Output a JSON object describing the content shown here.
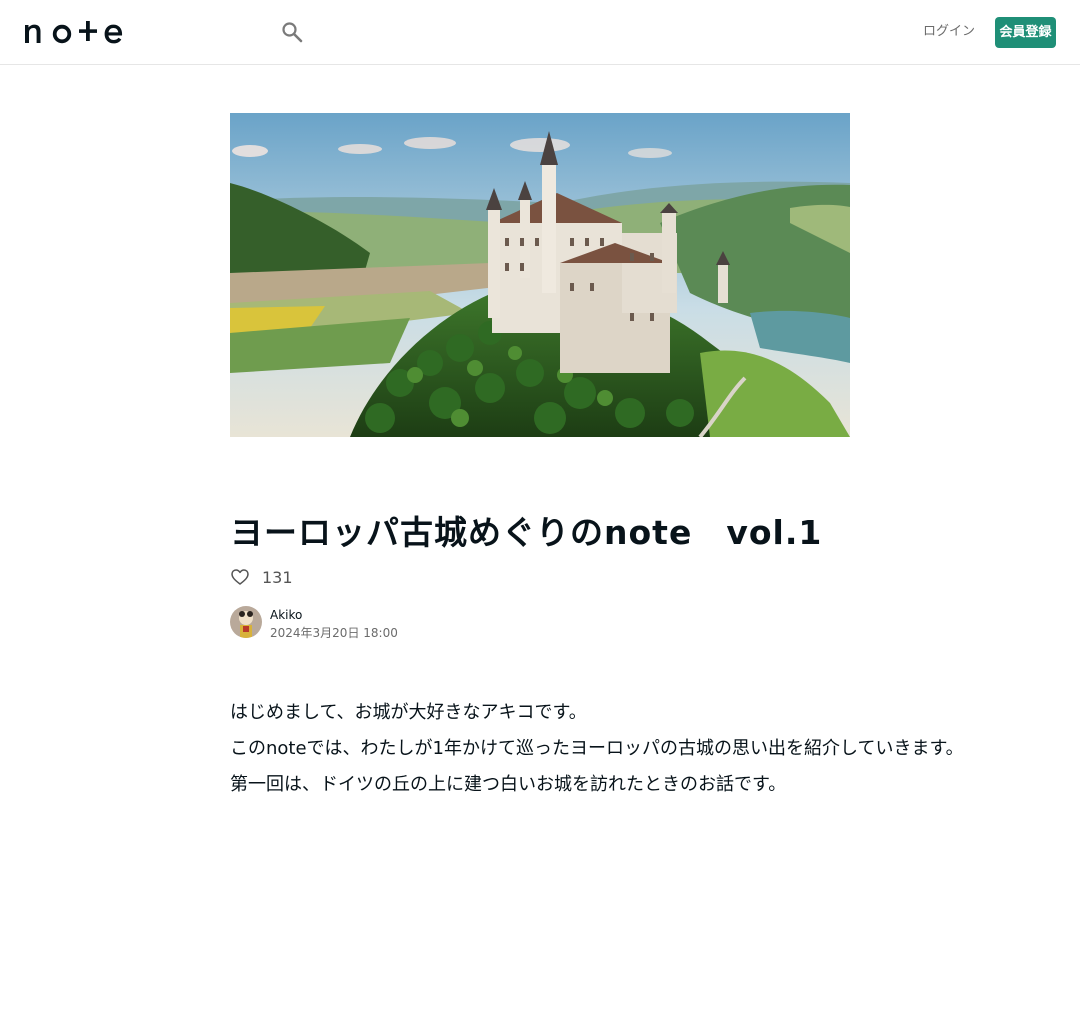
{
  "header": {
    "logo_text": "note",
    "search_icon": "search-icon",
    "login_label": "ログイン",
    "signup_label": "会員登録",
    "accent_color": "#1f8f77"
  },
  "article": {
    "hero_image": "castle-landscape",
    "title": "ヨーロッパ古城めぐりのnote　vol.1",
    "likes_count": "131",
    "author_name": "Akiko",
    "post_date": "2024年3月20日 18:00",
    "body": [
      "はじめまして、お城が大好きなアキコです。",
      "このnoteでは、わたしが1年かけて巡ったヨーロッパの古城の思い出を紹介していきます。",
      "第一回は、ドイツの丘の上に建つ白いお城を訪れたときのお話です。"
    ]
  }
}
